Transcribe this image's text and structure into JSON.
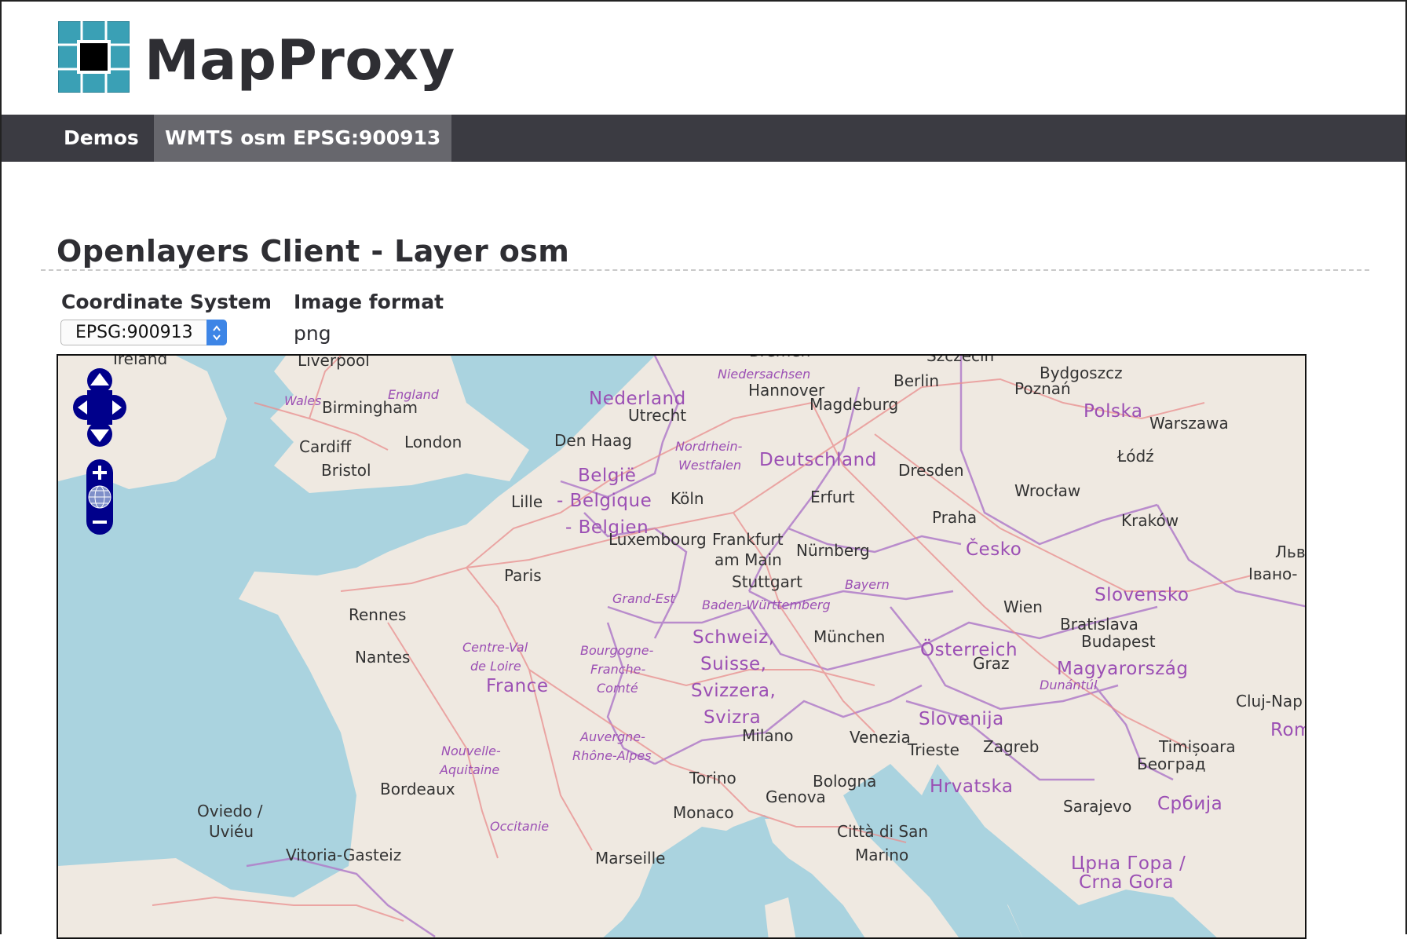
{
  "app": {
    "title": "MapProxy"
  },
  "nav": {
    "items": [
      {
        "label": "Demos"
      },
      {
        "label": "WMTS osm EPSG:900913"
      }
    ]
  },
  "page": {
    "title": "Openlayers Client - Layer osm"
  },
  "form": {
    "coord_label": "Coordinate System",
    "coord_value": "EPSG:900913",
    "format_label": "Image format",
    "format_value": "png"
  },
  "colors": {
    "brand": "#3aa0b5",
    "nav_bg": "#3b3b42",
    "nav_active": "#67676d",
    "select_accent": "#3d85e6",
    "map_land": "#efe9e1",
    "map_water": "#aad3df",
    "control_blue": "#00008b"
  },
  "map": {
    "controls": [
      "pan-up-icon",
      "pan-left-icon",
      "pan-right-icon",
      "pan-down-icon",
      "zoom-in-icon",
      "zoom-world-icon",
      "zoom-out-icon"
    ],
    "labels": [
      {
        "id": "ireland",
        "text": "Ireland",
        "kind": "city"
      },
      {
        "id": "liverpool",
        "text": "Liverpool",
        "kind": "city"
      },
      {
        "id": "bremen",
        "text": "Bremen",
        "kind": "city"
      },
      {
        "id": "szczecin",
        "text": "Szczecin",
        "kind": "city"
      },
      {
        "id": "niedersachsen",
        "text": "Niedersachsen",
        "kind": "region"
      },
      {
        "id": "bydgoszcz",
        "text": "Bydgoszcz",
        "kind": "city"
      },
      {
        "id": "england",
        "text": "England",
        "kind": "region"
      },
      {
        "id": "wales",
        "text": "Wales",
        "kind": "region"
      },
      {
        "id": "birmingham",
        "text": "Birmingham",
        "kind": "city"
      },
      {
        "id": "nederland",
        "text": "Nederland",
        "kind": "country"
      },
      {
        "id": "hannover",
        "text": "Hannover",
        "kind": "city"
      },
      {
        "id": "berlin",
        "text": "Berlin",
        "kind": "city"
      },
      {
        "id": "poznan",
        "text": "Poznań",
        "kind": "city"
      },
      {
        "id": "polska",
        "text": "Polska",
        "kind": "country"
      },
      {
        "id": "utrecht",
        "text": "Utrecht",
        "kind": "city"
      },
      {
        "id": "magdeburg",
        "text": "Magdeburg",
        "kind": "city"
      },
      {
        "id": "warszawa",
        "text": "Warszawa",
        "kind": "city"
      },
      {
        "id": "cardiff",
        "text": "Cardiff",
        "kind": "city"
      },
      {
        "id": "london",
        "text": "London",
        "kind": "city"
      },
      {
        "id": "denhaag",
        "text": "Den Haag",
        "kind": "city"
      },
      {
        "id": "nordrhein",
        "text": "Nordrhein-",
        "kind": "region"
      },
      {
        "id": "westfalen",
        "text": "Westfalen",
        "kind": "region"
      },
      {
        "id": "lodz",
        "text": "Łódź",
        "kind": "city"
      },
      {
        "id": "bristol",
        "text": "Bristol",
        "kind": "city"
      },
      {
        "id": "belgie",
        "text": "België",
        "kind": "country"
      },
      {
        "id": "deutschland",
        "text": "Deutschland",
        "kind": "country"
      },
      {
        "id": "dresden",
        "text": "Dresden",
        "kind": "city"
      },
      {
        "id": "wroclaw",
        "text": "Wrocław",
        "kind": "city"
      },
      {
        "id": "lille",
        "text": "Lille",
        "kind": "city"
      },
      {
        "id": "belgique",
        "text": "- Belgique",
        "kind": "country"
      },
      {
        "id": "koln",
        "text": "Köln",
        "kind": "city"
      },
      {
        "id": "erfurt",
        "text": "Erfurt",
        "kind": "city"
      },
      {
        "id": "praha",
        "text": "Praha",
        "kind": "city"
      },
      {
        "id": "krakow",
        "text": "Kraków",
        "kind": "city"
      },
      {
        "id": "belgien",
        "text": "- Belgien",
        "kind": "country"
      },
      {
        "id": "luxembourg",
        "text": "Luxembourg",
        "kind": "city"
      },
      {
        "id": "frankfurt",
        "text": "Frankfurt",
        "kind": "city"
      },
      {
        "id": "ammain",
        "text": "am Main",
        "kind": "city"
      },
      {
        "id": "nurnberg",
        "text": "Nürnberg",
        "kind": "city"
      },
      {
        "id": "cesko",
        "text": "Česko",
        "kind": "country"
      },
      {
        "id": "lviv",
        "text": "Льв",
        "kind": "city"
      },
      {
        "id": "ivano",
        "text": "Івано-",
        "kind": "city"
      },
      {
        "id": "paris",
        "text": "Paris",
        "kind": "city"
      },
      {
        "id": "stuttgart",
        "text": "Stuttgart",
        "kind": "city"
      },
      {
        "id": "bayern",
        "text": "Bayern",
        "kind": "region"
      },
      {
        "id": "grandest",
        "text": "Grand-Est",
        "kind": "region"
      },
      {
        "id": "bw",
        "text": "Baden-Württemberg",
        "kind": "region"
      },
      {
        "id": "slovensko",
        "text": "Slovensko",
        "kind": "country"
      },
      {
        "id": "rennes",
        "text": "Rennes",
        "kind": "city"
      },
      {
        "id": "wien",
        "text": "Wien",
        "kind": "city"
      },
      {
        "id": "bratislava",
        "text": "Bratislava",
        "kind": "city"
      },
      {
        "id": "munchen",
        "text": "München",
        "kind": "city"
      },
      {
        "id": "schweiz",
        "text": "Schweiz,",
        "kind": "country"
      },
      {
        "id": "budapest",
        "text": "Budapest",
        "kind": "city"
      },
      {
        "id": "centreval",
        "text": "Centre-Val",
        "kind": "region"
      },
      {
        "id": "deloire",
        "text": "de Loire",
        "kind": "region"
      },
      {
        "id": "nantes",
        "text": "Nantes",
        "kind": "city"
      },
      {
        "id": "bourgogne",
        "text": "Bourgogne-",
        "kind": "region"
      },
      {
        "id": "osterreich",
        "text": "Österreich",
        "kind": "country"
      },
      {
        "id": "suisse",
        "text": "Suisse,",
        "kind": "country"
      },
      {
        "id": "graz",
        "text": "Graz",
        "kind": "city"
      },
      {
        "id": "magyar",
        "text": "Magyarország",
        "kind": "country"
      },
      {
        "id": "franche",
        "text": "Franche-",
        "kind": "region"
      },
      {
        "id": "comte",
        "text": "Comté",
        "kind": "region"
      },
      {
        "id": "dunantul",
        "text": "Dunántúl",
        "kind": "region"
      },
      {
        "id": "france",
        "text": "France",
        "kind": "country"
      },
      {
        "id": "svizzera",
        "text": "Svizzera,",
        "kind": "country"
      },
      {
        "id": "clujnap",
        "text": "Cluj-Nap",
        "kind": "city"
      },
      {
        "id": "svizra",
        "text": "Svizra",
        "kind": "country"
      },
      {
        "id": "slovenija",
        "text": "Slovenija",
        "kind": "country"
      },
      {
        "id": "rom",
        "text": "Rom",
        "kind": "country"
      },
      {
        "id": "auvergne",
        "text": "Auvergne-",
        "kind": "region"
      },
      {
        "id": "milano",
        "text": "Milano",
        "kind": "city"
      },
      {
        "id": "venezia",
        "text": "Venezia",
        "kind": "city"
      },
      {
        "id": "zagreb",
        "text": "Zagreb",
        "kind": "city"
      },
      {
        "id": "nouvelle",
        "text": "Nouvelle-",
        "kind": "region"
      },
      {
        "id": "timisoara",
        "text": "Timișoara",
        "kind": "city"
      },
      {
        "id": "rhonealpes",
        "text": "Rhône-Alpes",
        "kind": "region"
      },
      {
        "id": "trieste",
        "text": "Trieste",
        "kind": "city"
      },
      {
        "id": "aquitaine",
        "text": "Aquitaine",
        "kind": "region"
      },
      {
        "id": "beograd",
        "text": "Београд",
        "kind": "city"
      },
      {
        "id": "torino",
        "text": "Torino",
        "kind": "city"
      },
      {
        "id": "bologna",
        "text": "Bologna",
        "kind": "city"
      },
      {
        "id": "bordeaux",
        "text": "Bordeaux",
        "kind": "city"
      },
      {
        "id": "hrvatska",
        "text": "Hrvatska",
        "kind": "country"
      },
      {
        "id": "genova",
        "text": "Genova",
        "kind": "city"
      },
      {
        "id": "sarajevo",
        "text": "Sarajevo",
        "kind": "city"
      },
      {
        "id": "srbija",
        "text": "Србија",
        "kind": "country"
      },
      {
        "id": "oviedo",
        "text": "Oviedo /",
        "kind": "city"
      },
      {
        "id": "monaco",
        "text": "Monaco",
        "kind": "city"
      },
      {
        "id": "uvieu",
        "text": "Uviéu",
        "kind": "city"
      },
      {
        "id": "occitanie",
        "text": "Occitanie",
        "kind": "region"
      },
      {
        "id": "cittadisan",
        "text": "Città di San",
        "kind": "city"
      },
      {
        "id": "vitoria",
        "text": "Vitoria-Gasteiz",
        "kind": "city"
      },
      {
        "id": "marino",
        "text": "Marino",
        "kind": "city"
      },
      {
        "id": "marseille",
        "text": "Marseille",
        "kind": "city"
      },
      {
        "id": "crnagora",
        "text": "Црна Гора /",
        "kind": "country"
      },
      {
        "id": "crnagora2",
        "text": "Crna Gora",
        "kind": "country"
      }
    ]
  }
}
